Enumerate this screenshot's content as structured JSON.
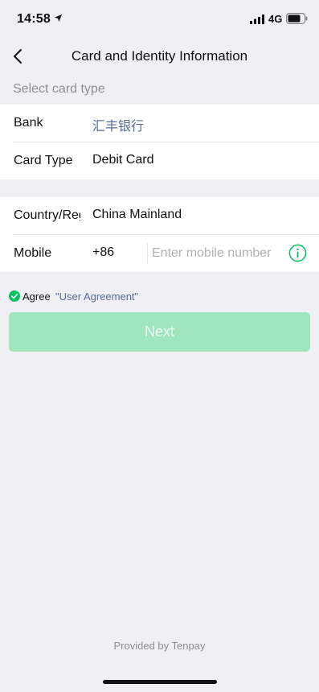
{
  "status_bar": {
    "time": "14:58",
    "network": "4G"
  },
  "nav": {
    "title": "Card and Identity Information",
    "back_icon": "chevron-left-icon"
  },
  "section": {
    "select_card_type": "Select card type"
  },
  "card": {
    "bank_label": "Bank",
    "bank_value": "汇丰银行",
    "card_type_label": "Card Type",
    "card_type_value": "Debit Card"
  },
  "identity": {
    "country_label": "Country/Region",
    "country_value": "China Mainland",
    "mobile_label": "Mobile",
    "country_code": "+86",
    "mobile_placeholder": "Enter mobile number",
    "mobile_value": ""
  },
  "agreement": {
    "agree_label": "Agree",
    "link_label": "\"User Agreement\"",
    "checked": true
  },
  "next_button": {
    "label": "Next",
    "enabled": false
  },
  "footer": {
    "provided_by": "Provided by Tenpay"
  },
  "colors": {
    "accent_green": "#07c160",
    "link_blue": "#576b95",
    "disabled_button": "#9fe6bf",
    "background": "#efeff4"
  }
}
